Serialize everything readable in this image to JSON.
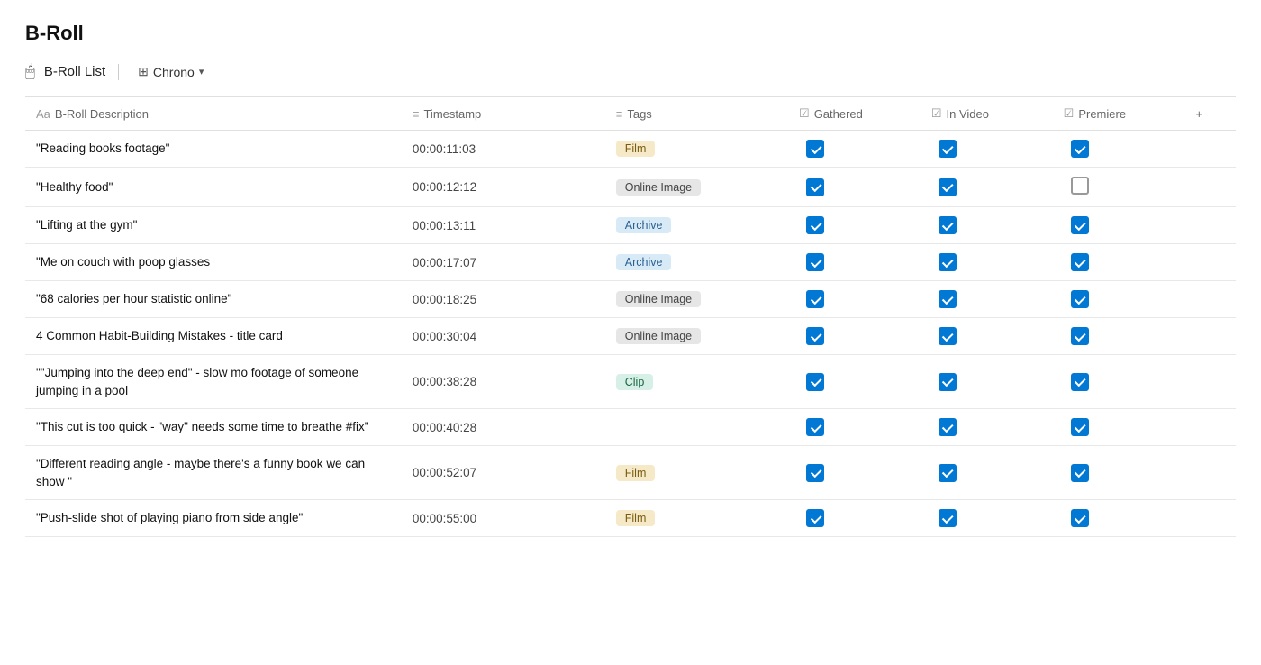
{
  "page": {
    "title": "B-Roll"
  },
  "toolbar": {
    "icon": "🖱",
    "list_label": "B-Roll List",
    "view_icon": "⊞",
    "view_label": "Chrono",
    "chevron": "▾"
  },
  "table": {
    "columns": [
      {
        "id": "desc",
        "icon": "Aa",
        "label": "B-Roll Description"
      },
      {
        "id": "timestamp",
        "icon": "≡",
        "label": "Timestamp"
      },
      {
        "id": "tags",
        "icon": "≡",
        "label": "Tags"
      },
      {
        "id": "gathered",
        "icon": "☑",
        "label": "Gathered"
      },
      {
        "id": "invideo",
        "icon": "☑",
        "label": "In Video"
      },
      {
        "id": "premiere",
        "icon": "☑",
        "label": "Premiere"
      },
      {
        "id": "add",
        "icon": "+",
        "label": ""
      }
    ],
    "rows": [
      {
        "desc": "\"Reading books footage\"",
        "timestamp": "00:00:11:03",
        "tag": "Film",
        "tag_type": "film",
        "gathered": true,
        "invideo": true,
        "premiere": true
      },
      {
        "desc": "\"Healthy food\"",
        "timestamp": "00:00:12:12",
        "tag": "Online Image",
        "tag_type": "online-image",
        "gathered": true,
        "invideo": true,
        "premiere": false
      },
      {
        "desc": "\"Lifting at the gym\"",
        "timestamp": "00:00:13:11",
        "tag": "Archive",
        "tag_type": "archive",
        "gathered": true,
        "invideo": true,
        "premiere": true
      },
      {
        "desc": "\"Me on couch with poop glasses",
        "timestamp": "00:00:17:07",
        "tag": "Archive",
        "tag_type": "archive",
        "gathered": true,
        "invideo": true,
        "premiere": true
      },
      {
        "desc": "\"68 calories per hour statistic online\"",
        "timestamp": "00:00:18:25",
        "tag": "Online Image",
        "tag_type": "online-image",
        "gathered": true,
        "invideo": true,
        "premiere": true
      },
      {
        "desc": "4 Common Habit-Building Mistakes - title card",
        "timestamp": "00:00:30:04",
        "tag": "Online Image",
        "tag_type": "online-image",
        "gathered": true,
        "invideo": true,
        "premiere": true
      },
      {
        "desc": "\"\"Jumping into the deep end\" - slow mo footage of someone jumping in a pool",
        "timestamp": "00:00:38:28",
        "tag": "Clip",
        "tag_type": "clip",
        "gathered": true,
        "invideo": true,
        "premiere": true
      },
      {
        "desc": "\"This cut is too quick - \"way\" needs some time to breathe #fix\"",
        "timestamp": "00:00:40:28",
        "tag": "",
        "tag_type": "",
        "gathered": true,
        "invideo": true,
        "premiere": true
      },
      {
        "desc": "\"Different reading angle - maybe there's a funny book we can show \"",
        "timestamp": "00:00:52:07",
        "tag": "Film",
        "tag_type": "film",
        "gathered": true,
        "invideo": true,
        "premiere": true
      },
      {
        "desc": "\"Push-slide shot of playing piano from side angle\"",
        "timestamp": "00:00:55:00",
        "tag": "Film",
        "tag_type": "film",
        "gathered": true,
        "invideo": true,
        "premiere": true
      }
    ]
  }
}
